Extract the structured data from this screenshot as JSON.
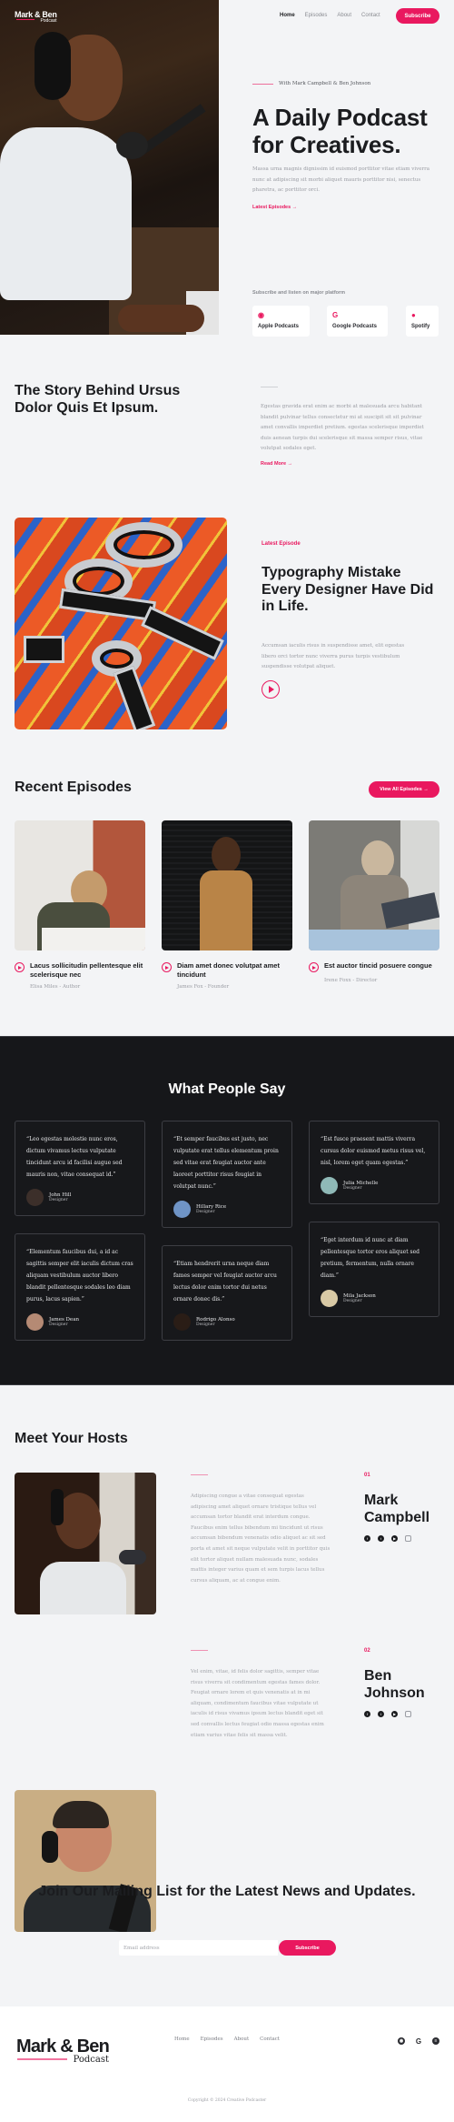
{
  "brand": {
    "name": "Mark & Ben",
    "sub": "Podcast",
    "accent": "#e9185f",
    "dark_bg": "#16171a",
    "page_bg": "#f3f4f6"
  },
  "nav": {
    "items": [
      "Home",
      "Episodes",
      "About",
      "Contact"
    ],
    "active": "Home",
    "subscribe": "Subscribe"
  },
  "hero": {
    "kicker": "With Mark Campbell & Ben Johnson",
    "title": "A Daily Podcast for Creatives.",
    "description": "Massa urna magnis dignissim id euismod porttitor vitae etiam viverra nunc at adipiscing sit morbi aliquet mauris porttitor nisi, senectus pharetra, ac porttitor orci.",
    "link": "Latest Episodes →",
    "subscribe_label": "Subscribe and listen on major platform",
    "platforms": [
      {
        "name": "Apple Podcasts",
        "icon": "apple-podcasts-icon"
      },
      {
        "name": "Google Podcasts",
        "icon": "google-podcasts-icon"
      },
      {
        "name": "Spotify",
        "icon": "spotify-icon"
      }
    ]
  },
  "story": {
    "title": "The Story Behind Ursus Dolor Quis Et Ipsum.",
    "text": "Egestas gravida erat enim ac morbi at malesuada arcu habitant blandit pulvinar tellus consectetur mi at suscipit sit sit pulvinar amet convallis imperdiet pretium. egestas scelerisque imperdiet duis aenean turpis dui scelerisque sit massa semper risus, vitae volutpat sodales eget.",
    "link": "Read More →"
  },
  "latest": {
    "kicker": "Latest Episode",
    "title": "Typography Mistake Every Designer Have Did in Life.",
    "description": "Accumsan iaculis risus in suspendisse amet, elit egestas libero orci tortor nunc viverra purus turpis vestibulum suspendisse volutpat aliquet."
  },
  "recent": {
    "title": "Recent Episodes",
    "view_all": "View All Episodes →",
    "episodes": [
      {
        "title": "Lacus sollicitudin pellentesque elit scelerisque nec",
        "meta": "Elisa Miles - Author"
      },
      {
        "title": "Diam amet donec volutpat amet tincidunt",
        "meta": "James Fox - Founder"
      },
      {
        "title": "Est auctor tincid posuere congue",
        "meta": "Irene Foxx - Director"
      }
    ]
  },
  "testimonials": {
    "title": "What People Say",
    "items": [
      {
        "quote": "“Leo egestas molestie nunc eros, dictum vivamus lectus vulputate tincidunt arcu id facilisi augue sed mauris non, vitae consequat id.”",
        "name": "John Hill",
        "role": "Designer"
      },
      {
        "quote": "“Et semper faucibus est justo, nec vulputate erat tellus elementum proin sed vitae erat feugiat auctor ante laoreet porttitor risus feugiat in volutpat nunc.”",
        "name": "Hillary Rice",
        "role": "Designer"
      },
      {
        "quote": "“Est fusce praesent mattis viverra cursus dolor euismod metus risus vel, nisl, lorem eget quam egestas.”",
        "name": "Julia Michelle",
        "role": "Designer"
      },
      {
        "quote": "“Elementum faucibus dui, a id ac sagittis semper elit iaculis dictum cras aliquam vestibulum auctor libero blandit pellentesque sodales leo diam purus, lacus sapien.”",
        "name": "James Dean",
        "role": "Designer"
      },
      {
        "quote": "“Etiam hendrerit urna neque diam fames semper vel feugiat auctor arcu lectus dolor enim tortor dui netus ornare donec dis.”",
        "name": "Rodrigo Alonso",
        "role": "Designer"
      },
      {
        "quote": "“Eget interdum id nunc at diam pellentesque tortor eros aliquet sed pretium, fermentum, nulla ornare diam.”",
        "name": "Mila Jackson",
        "role": "Designer"
      }
    ]
  },
  "hosts": {
    "title": "Meet Your Hosts",
    "items": [
      {
        "num": "01",
        "first": "Mark",
        "last": "Campbell",
        "text": "Adipiscing congue a vitae consequat egestas adipiscing amet aliquet ornare tristique tellus vel accumsan tortor blandit erat interdum congue. Faucibus enim tellus bibendum mi tincidunt ut risus accumsan bibendum venenatis odio aliquet ac sit sed porta et amet sit neque vulputate velit in porttitor quis elit tortor aliquet nullam malesuada nunc, sodales mattis integer varius quam et sem turpis lacus tellus cursus aliquam, ac at congue enim."
      },
      {
        "num": "02",
        "first": "Ben",
        "last": "Johnson",
        "text": "Vel enim, vitae, id felis dolor sagittis, semper vitae risus viverra sit condimentum egestas fames dolor. Feugiat ornare lorem et quis venenatis at in mi aliquam, condimentum faucibus vitae vulputate ut iaculis id risus vivamus ipsum lectus blandit eget sit sed convallis lectus feugiat odio massa egestas enim etiam varius vitae felis sit massa velit."
      }
    ],
    "social": [
      "facebook-icon",
      "twitter-icon",
      "youtube-icon",
      "instagram-icon"
    ]
  },
  "mailing": {
    "title": "Join Our Mailing List for the Latest News and Updates.",
    "placeholder": "Email address",
    "button": "Subscribe"
  },
  "footer": {
    "nav": [
      "Home",
      "Episodes",
      "About",
      "Contact"
    ],
    "social": [
      "apple-podcasts-icon",
      "google-podcasts-icon",
      "spotify-icon"
    ],
    "copyright": "Copyright © 2024 Creative Podcaster"
  }
}
